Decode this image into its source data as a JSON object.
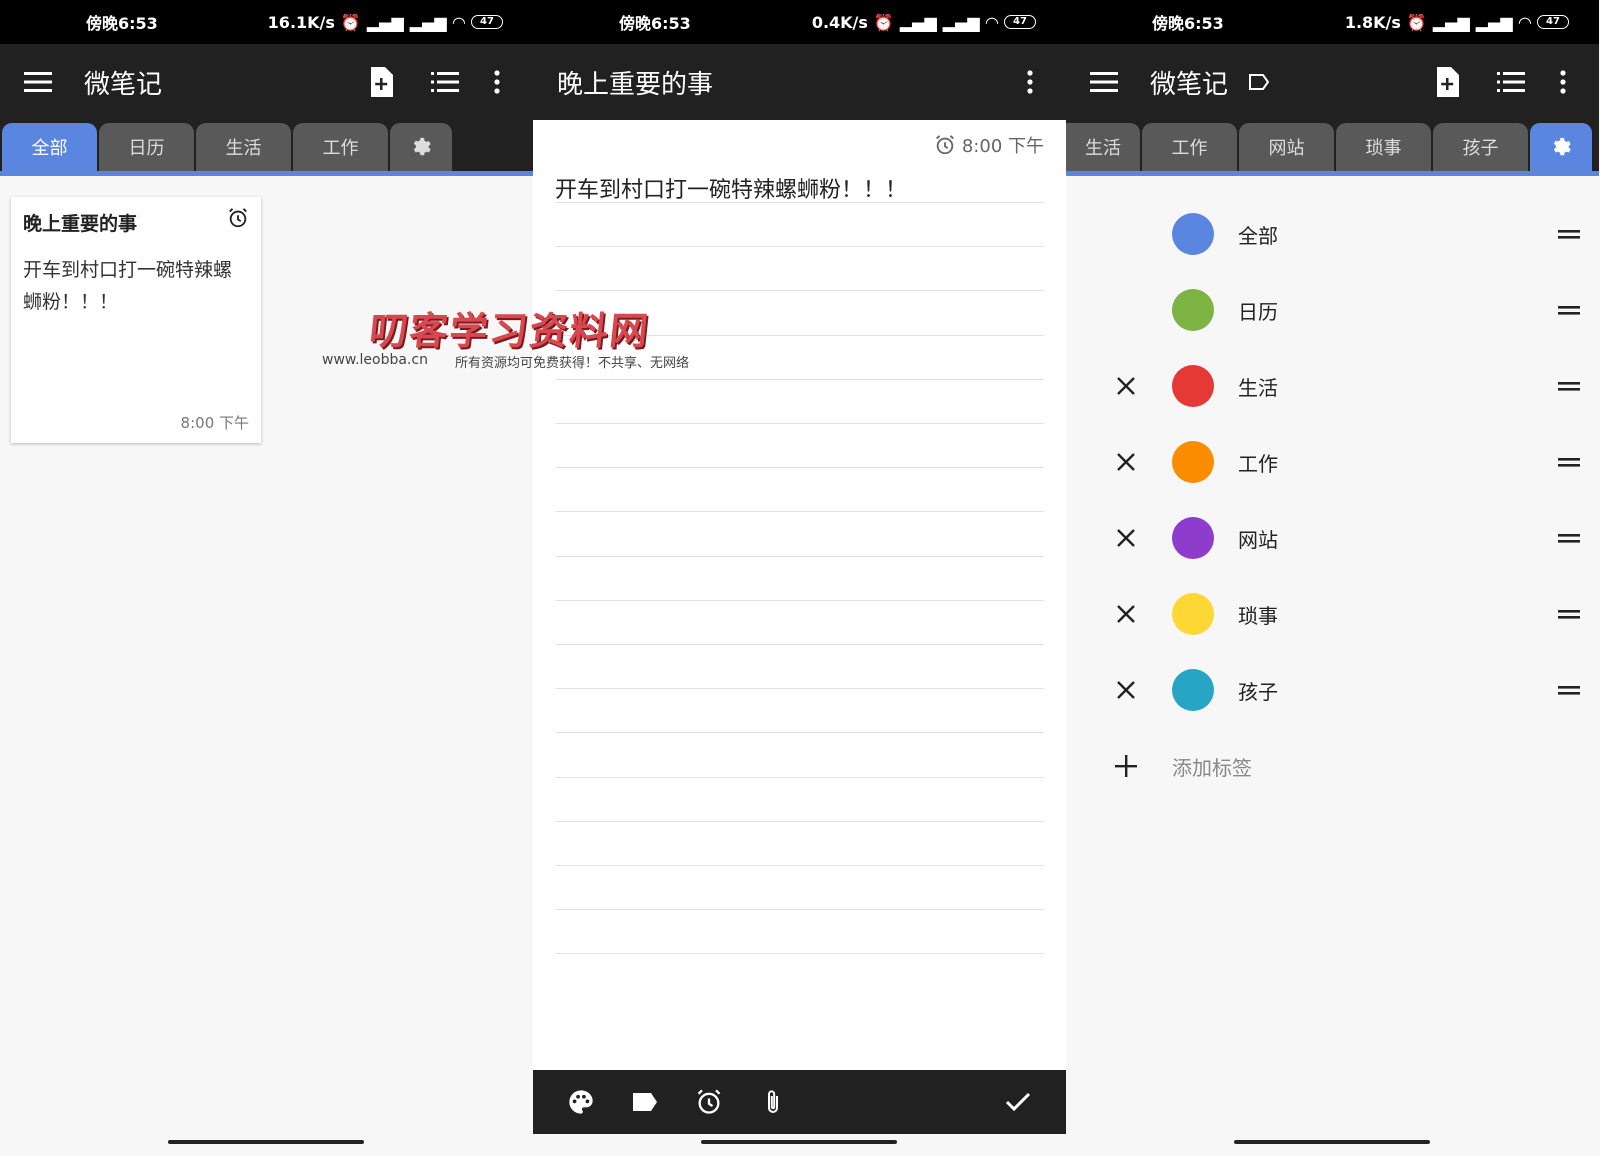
{
  "status": {
    "p1": {
      "time": "傍晚6:53",
      "speed": "16.1K/s",
      "battery": "47"
    },
    "p2": {
      "time": "傍晚6:53",
      "speed": "0.4K/s",
      "battery": "47"
    },
    "p3": {
      "time": "傍晚6:53",
      "speed": "1.8K/s",
      "battery": "47"
    }
  },
  "screen1": {
    "title": "微笔记",
    "tabs": [
      "全部",
      "日历",
      "生活",
      "工作"
    ],
    "note": {
      "title": "晚上重要的事",
      "body": "开车到村口打一碗特辣螺蛳粉！！！",
      "time": "8:00 下午"
    }
  },
  "screen2": {
    "title": "晚上重要的事",
    "reminder": "8:00 下午",
    "content": "开车到村口打一碗特辣螺蛳粉！！！"
  },
  "screen3": {
    "title": "微笔记",
    "tabs": [
      "生活",
      "工作",
      "网站",
      "琐事",
      "孩子"
    ],
    "labels": [
      {
        "name": "全部",
        "color": "#5a86e0",
        "removable": false
      },
      {
        "name": "日历",
        "color": "#7cb342",
        "removable": false
      },
      {
        "name": "生活",
        "color": "#e53935",
        "removable": true
      },
      {
        "name": "工作",
        "color": "#fb8c00",
        "removable": true
      },
      {
        "name": "网站",
        "color": "#8e3ccb",
        "removable": true
      },
      {
        "name": "琐事",
        "color": "#fdd835",
        "removable": true
      },
      {
        "name": "孩子",
        "color": "#26a5c4",
        "removable": true
      }
    ],
    "add_label": "添加标签"
  },
  "watermark": {
    "title": "叨客学习资料网",
    "url": "www.leobba.cn",
    "sub": "所有资源均可免费获得！不共享、无网络"
  },
  "colors": {
    "accent": "#5a86e0",
    "appbar": "#212121"
  }
}
